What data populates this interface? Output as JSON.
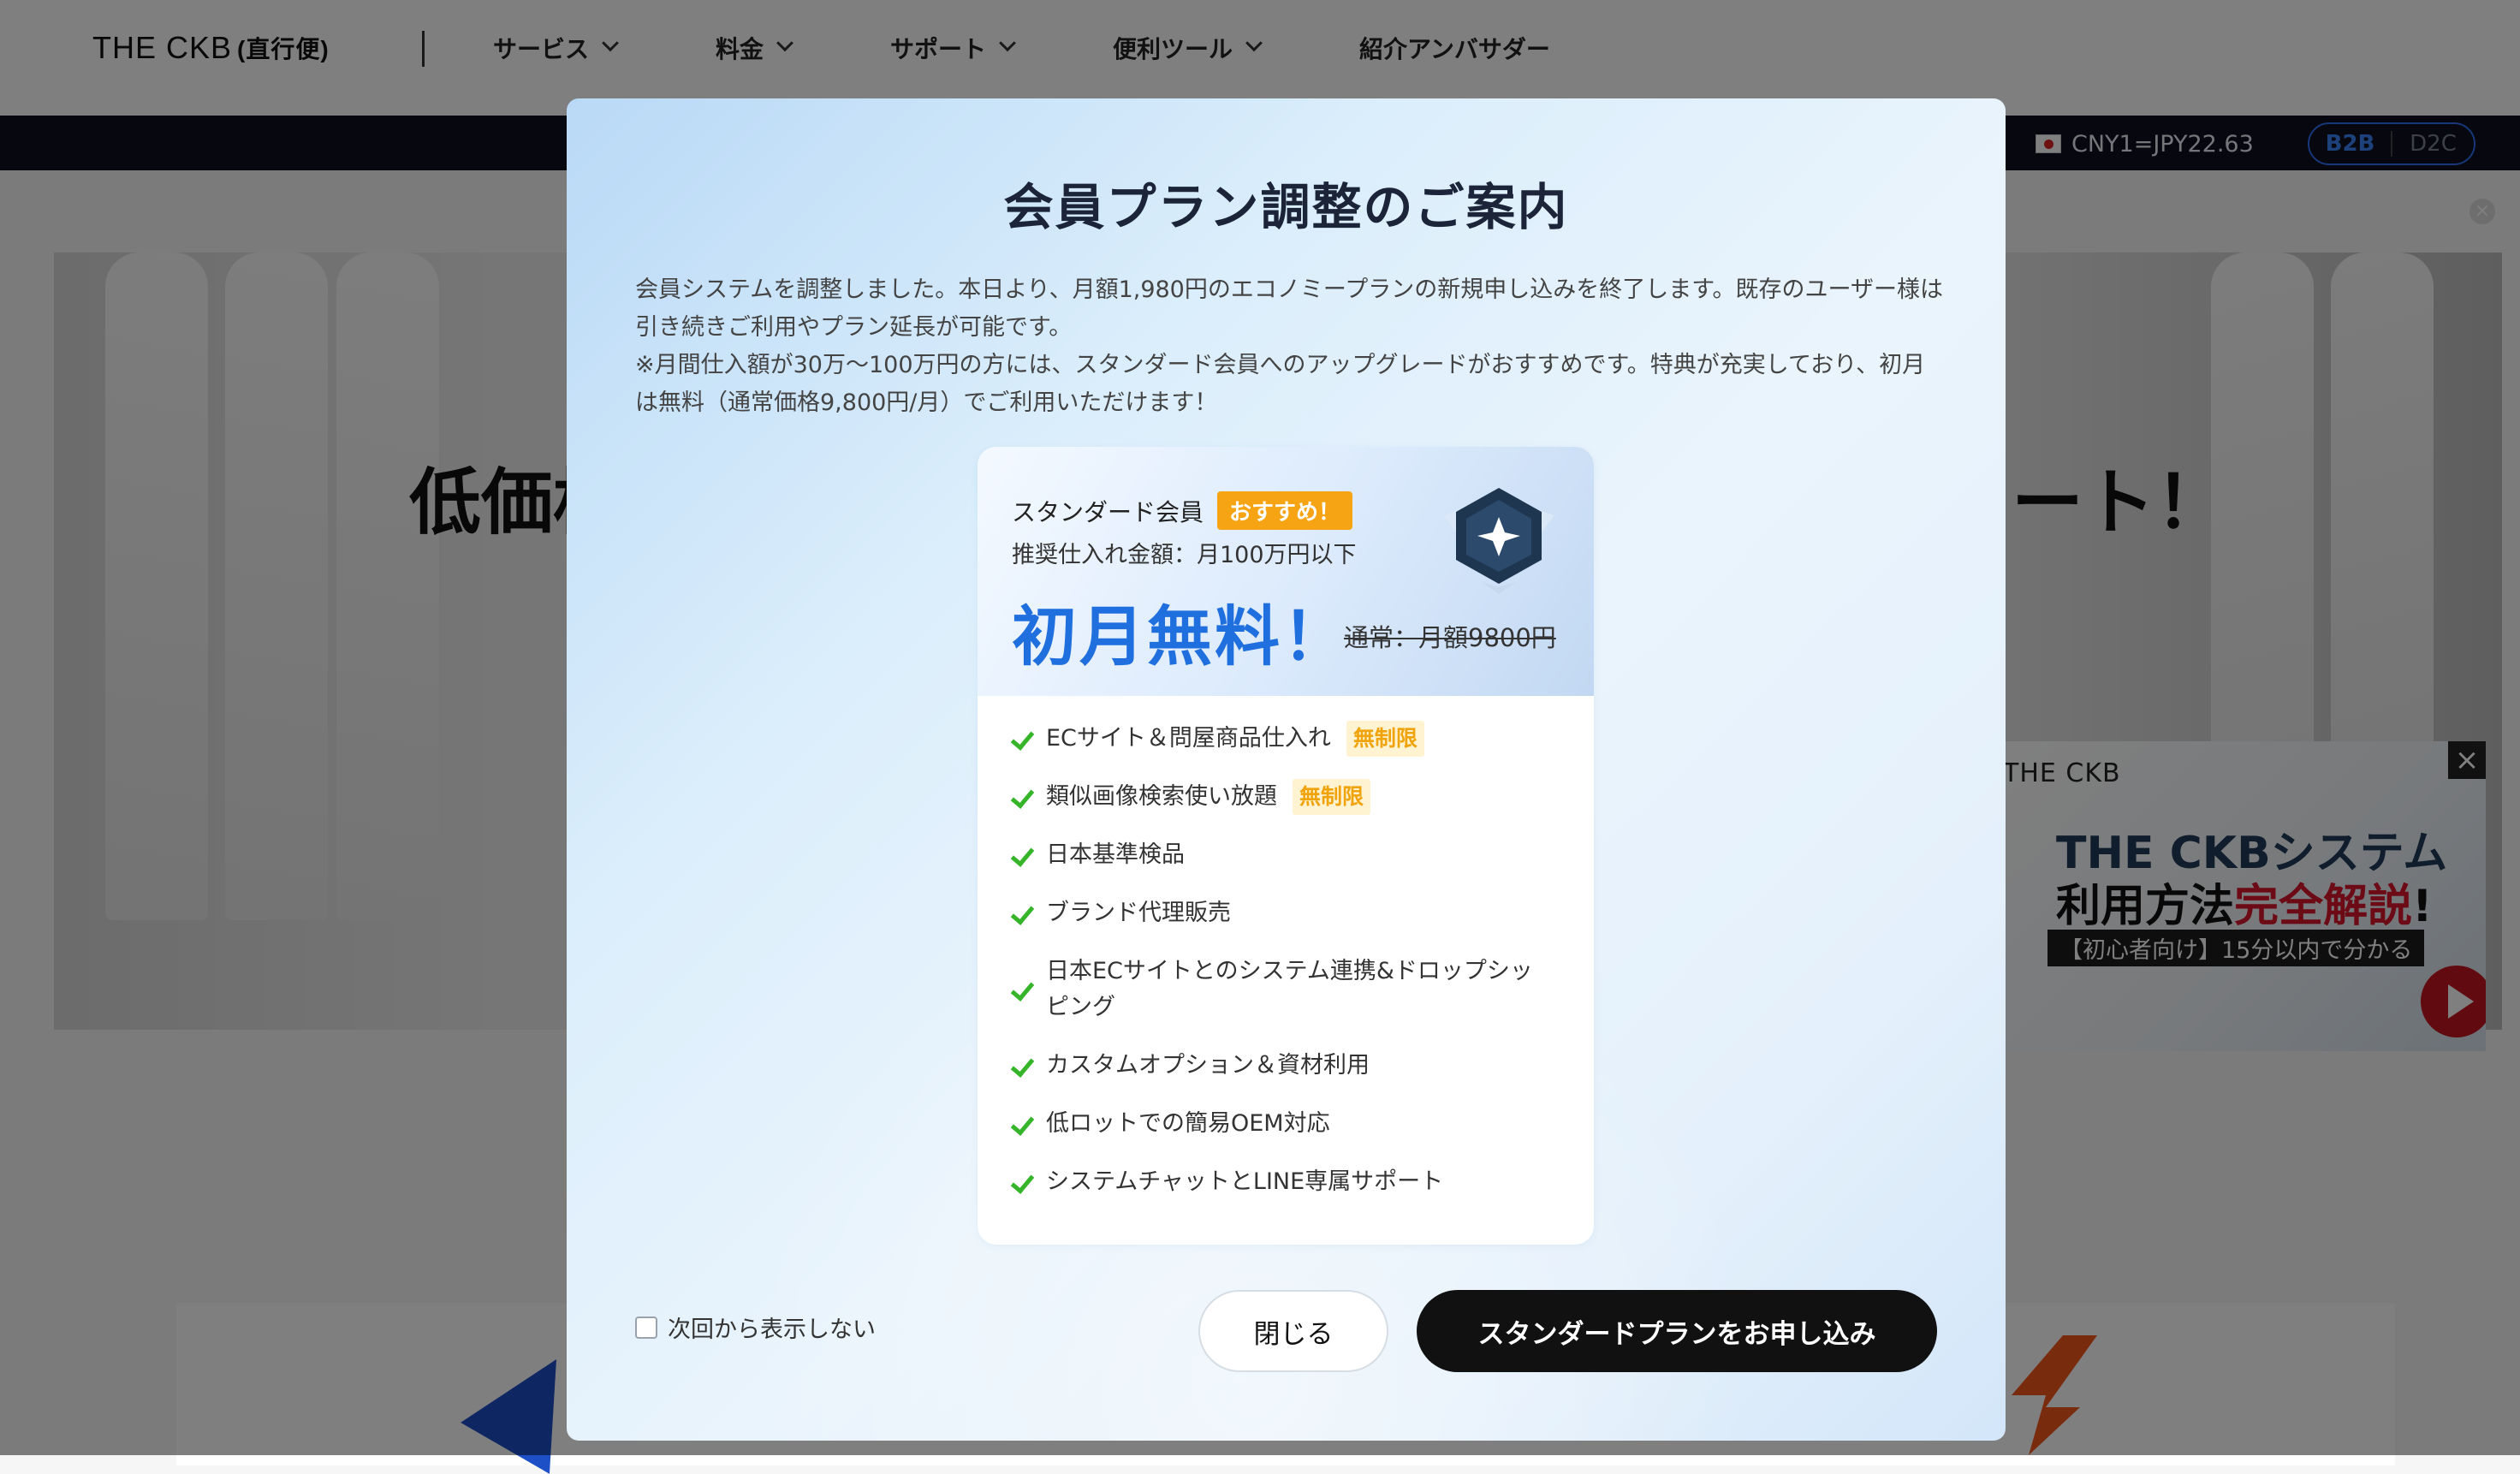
{
  "header": {
    "logo": "THE CKB",
    "logo_sub": "(直行便)",
    "nav": [
      {
        "label": "サービス"
      },
      {
        "label": "料金"
      },
      {
        "label": "サポート"
      },
      {
        "label": "便利ツール"
      },
      {
        "label": "紹介アンバサダー"
      }
    ],
    "rate": "CNY1=JPY22.63",
    "toggle_b2b": "B2B",
    "toggle_d2c": "D2C"
  },
  "hero": {
    "title_left": "低価格",
    "title_right": "ート！"
  },
  "promo": {
    "brand": "THE CKB",
    "line1": "THE CKBシステム",
    "line2_a": "利用方法",
    "line2_b": "完全解説",
    "line2_c": "!",
    "line3": "【初心者向け】15分以内で分かる",
    "close": "×"
  },
  "modal": {
    "title": "会員プラン調整のご案内",
    "body_1": "会員システムを調整しました。本日より、月額1,980円のエコノミープランの新規申し込みを終了します。既存のユーザー様は引き続きご利用やプラン延長が可能です。",
    "body_2": "※月間仕入額が30万〜100万円の方には、スタンダード会員へのアップグレードがおすすめです。特典が充実しており、初月は無料（通常価格9,800円/月）でご利用いただけます！",
    "card": {
      "plan_name": "スタンダード会員",
      "badge": "おすすめ！",
      "amount": "推奨仕入れ金額：月100万円以下",
      "free": "初月無料！",
      "regular": "通常：月額9800円",
      "features": [
        {
          "text": "ECサイト＆問屋商品仕入れ",
          "tag": "無制限"
        },
        {
          "text": "類似画像検索使い放題",
          "tag": "無制限"
        },
        {
          "text": "日本基準検品",
          "tag": ""
        },
        {
          "text": "ブランド代理販売",
          "tag": ""
        },
        {
          "text": "日本ECサイトとのシステム連携&ドロップシッピング",
          "tag": ""
        },
        {
          "text": "カスタムオプション＆資材利用",
          "tag": ""
        },
        {
          "text": "低ロットでの簡易OEM対応",
          "tag": ""
        },
        {
          "text": "システムチャットとLINE専属サポート",
          "tag": ""
        }
      ]
    },
    "dont_show": "次回から表示しない",
    "close_button": "閉じる",
    "apply_button": "スタンダードプランをお申し込み"
  },
  "icons": {
    "check": "check-icon",
    "chevron": "chevron-down-icon",
    "flag": "japan-flag-icon",
    "shield": "star-shield-icon",
    "play": "play-icon"
  },
  "colors": {
    "accent_blue": "#1f6fde",
    "badge_orange": "#f6a413",
    "check_green": "#36b52b",
    "apply_button": "#111111"
  }
}
